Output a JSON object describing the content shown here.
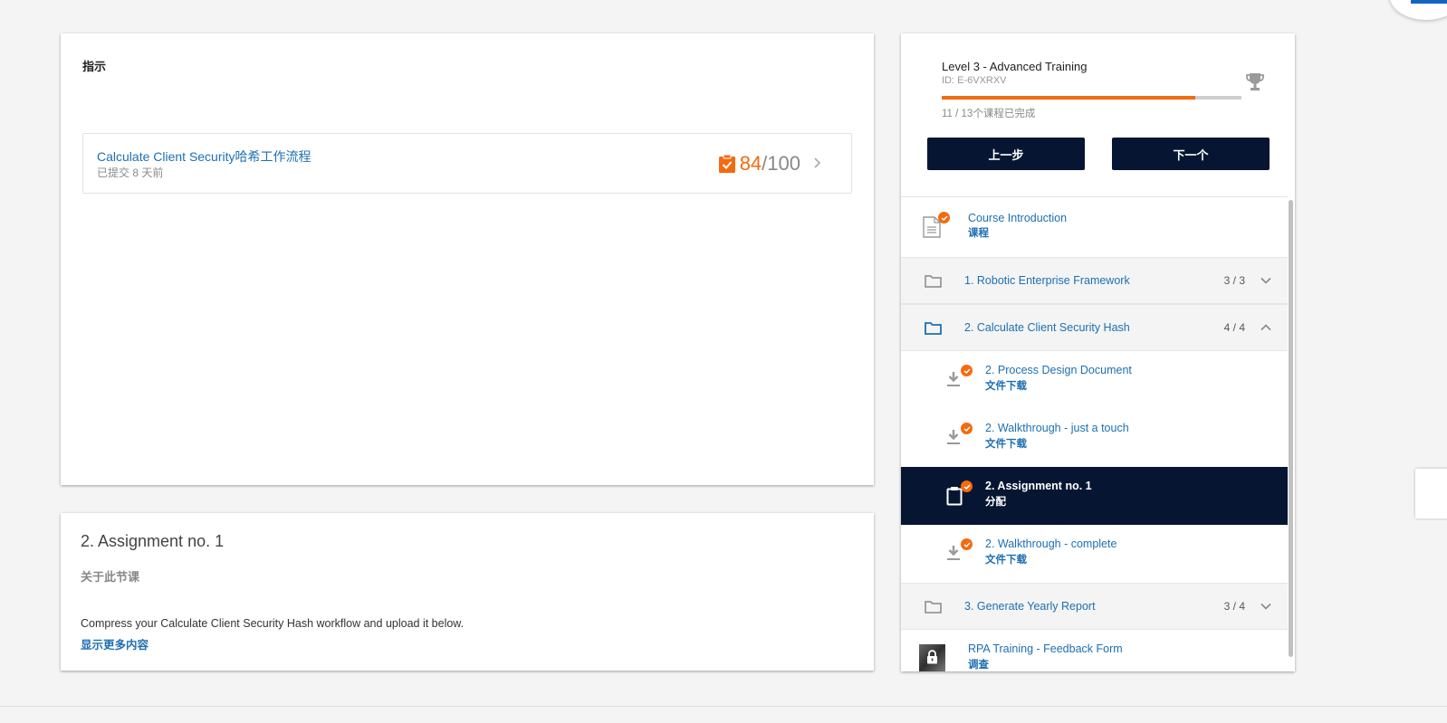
{
  "instructions": {
    "heading": "指示",
    "submission": {
      "title": "Calculate Client Security哈希工作流程",
      "submitted": "已提交 8 天前",
      "score": "84",
      "total": "/100",
      "icon": "clipboard-check-icon"
    }
  },
  "lesson": {
    "title": "2. Assignment no. 1",
    "about_label": "关于此节课",
    "description": "Compress your Calculate Client Security Hash workflow and upload it below.",
    "show_more": "显示更多内容"
  },
  "course": {
    "title": "Level 3 - Advanced Training",
    "id": "ID: E-6VXRXV",
    "progress_percent": 84.6,
    "progress_text": "11 / 13个课程已完成",
    "prev_label": "上一步",
    "next_label": "下一个",
    "trophy_icon": "trophy-icon"
  },
  "outline": {
    "course_intro": {
      "title": "Course Introduction",
      "type": "课程",
      "completed": true
    },
    "sections": [
      {
        "title": "1. Robotic Enterprise Framework",
        "count": "3 / 3",
        "expanded": false
      },
      {
        "title": "2. Calculate Client Security Hash",
        "count": "4 / 4",
        "expanded": true
      },
      {
        "title": "3. Generate Yearly Report",
        "count": "3 / 4",
        "expanded": false
      }
    ],
    "section2_items": [
      {
        "title": "2. Process Design Document",
        "type": "文件下载",
        "icon": "download-icon",
        "completed": true,
        "active": false
      },
      {
        "title": "2. Walkthrough - just a touch",
        "type": "文件下载",
        "icon": "download-icon",
        "completed": true,
        "active": false
      },
      {
        "title": "2. Assignment no. 1",
        "type": "分配",
        "icon": "clipboard-icon",
        "completed": true,
        "active": true
      },
      {
        "title": "2. Walkthrough - complete",
        "type": "文件下载",
        "icon": "download-icon",
        "completed": true,
        "active": false
      }
    ],
    "feedback": {
      "title": "RPA Training - Feedback Form",
      "type": "调查",
      "locked": true
    }
  },
  "colors": {
    "accent": "#f26b0f",
    "link": "#1d6fb1",
    "navy": "#061632"
  }
}
